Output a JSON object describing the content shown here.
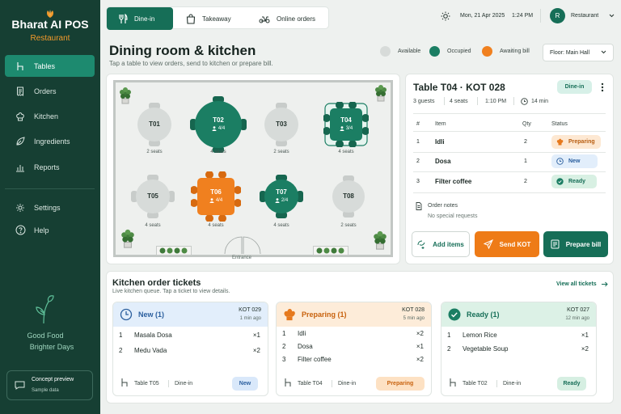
{
  "brand": {
    "title": "Bharat AI POS",
    "subtitle": "Restaurant"
  },
  "sidebar": {
    "items": [
      {
        "label": "Tables",
        "icon": "chair-icon"
      },
      {
        "label": "Orders",
        "icon": "receipt-icon"
      },
      {
        "label": "Kitchen",
        "icon": "chef-hat-icon"
      },
      {
        "label": "Ingredients",
        "icon": "leaf-icon"
      },
      {
        "label": "Reports",
        "icon": "bar-chart-icon"
      }
    ],
    "secondary": [
      {
        "label": "Settings",
        "icon": "gear-icon"
      },
      {
        "label": "Help",
        "icon": "help-icon"
      }
    ],
    "tagline_1": "Good Food",
    "tagline_2": "Brighter Days",
    "concept_title": "Concept preview",
    "concept_sub": "Sample data"
  },
  "topbar": {
    "tabs": [
      "Dine-in",
      "Takeaway",
      "Online orders"
    ],
    "date": "Mon, 21 Apr 2025",
    "time": "1:24 PM",
    "avatar": "R",
    "user": "Restaurant"
  },
  "header": {
    "title": "Dining room & kitchen",
    "subtitle": "Tap a table to view orders, send to kitchen or prepare bill.",
    "legend": [
      "Available",
      "Occupied",
      "Awaiting bill"
    ],
    "floor": "Floor: Main Hall"
  },
  "colors": {
    "primary": "#166e57",
    "occupied": "#1b7e63",
    "available": "#d7dbd9",
    "awaiting": "#f0801f",
    "sidebar": "#163f33"
  },
  "tables": [
    {
      "id": "T01",
      "seats": "2 seats",
      "status": "available",
      "count": ""
    },
    {
      "id": "T02",
      "seats": "4 seats",
      "status": "occupied",
      "count": "4/4"
    },
    {
      "id": "T03",
      "seats": "2 seats",
      "status": "available",
      "count": ""
    },
    {
      "id": "T04",
      "seats": "4 seats",
      "status": "occupied",
      "count": "3/4"
    },
    {
      "id": "T05",
      "seats": "4 seats",
      "status": "available",
      "count": ""
    },
    {
      "id": "T06",
      "seats": "4 seats",
      "status": "awaiting",
      "count": "4/4"
    },
    {
      "id": "T07",
      "seats": "4 seats",
      "status": "occupied",
      "count": "2/4"
    },
    {
      "id": "T08",
      "seats": "2 seats",
      "status": "available",
      "count": ""
    }
  ],
  "floor_entrance": "Entrance",
  "detail": {
    "title": "Table T04 · KOT 028",
    "badge": "Dine-in",
    "guests": "3 guests",
    "seats": "4 seats",
    "time": "1:10 PM",
    "duration": "14 min",
    "headers": [
      "#",
      "Item",
      "Qty",
      "Status"
    ],
    "items": [
      {
        "n": "1",
        "name": "Idli",
        "qty": "2",
        "status": "Preparing"
      },
      {
        "n": "2",
        "name": "Dosa",
        "qty": "1",
        "status": "New"
      },
      {
        "n": "3",
        "name": "Filter coffee",
        "qty": "2",
        "status": "Ready"
      }
    ],
    "notes_label": "Order notes",
    "notes_value": "No special requests",
    "buttons": {
      "add": "Add items",
      "send": "Send KOT",
      "bill": "Prepare bill"
    }
  },
  "kitchen": {
    "title": "Kitchen order tickets",
    "subtitle": "Live kitchen queue. Tap a ticket to view details.",
    "view_all": "View all tickets",
    "tickets": [
      {
        "name": "New (1)",
        "kot": "KOT 029",
        "ago": "1 min ago",
        "items": [
          {
            "n": "1",
            "name": "Masala Dosa",
            "q": "×1"
          },
          {
            "n": "2",
            "name": "Medu Vada",
            "q": "×2"
          }
        ],
        "table": "Table T05",
        "type": "Dine-in",
        "badge": "New"
      },
      {
        "name": "Preparing (1)",
        "kot": "KOT 028",
        "ago": "5 min ago",
        "items": [
          {
            "n": "1",
            "name": "Idli",
            "q": "×2"
          },
          {
            "n": "2",
            "name": "Dosa",
            "q": "×1"
          },
          {
            "n": "3",
            "name": "Filter coffee",
            "q": "×2"
          }
        ],
        "table": "Table T04",
        "type": "Dine-in",
        "badge": "Preparing"
      },
      {
        "name": "Ready (1)",
        "kot": "KOT 027",
        "ago": "12 min ago",
        "items": [
          {
            "n": "1",
            "name": "Lemon Rice",
            "q": "×1"
          },
          {
            "n": "2",
            "name": "Vegetable Soup",
            "q": "×2"
          }
        ],
        "table": "Table T02",
        "type": "Dine-in",
        "badge": "Ready"
      }
    ]
  }
}
